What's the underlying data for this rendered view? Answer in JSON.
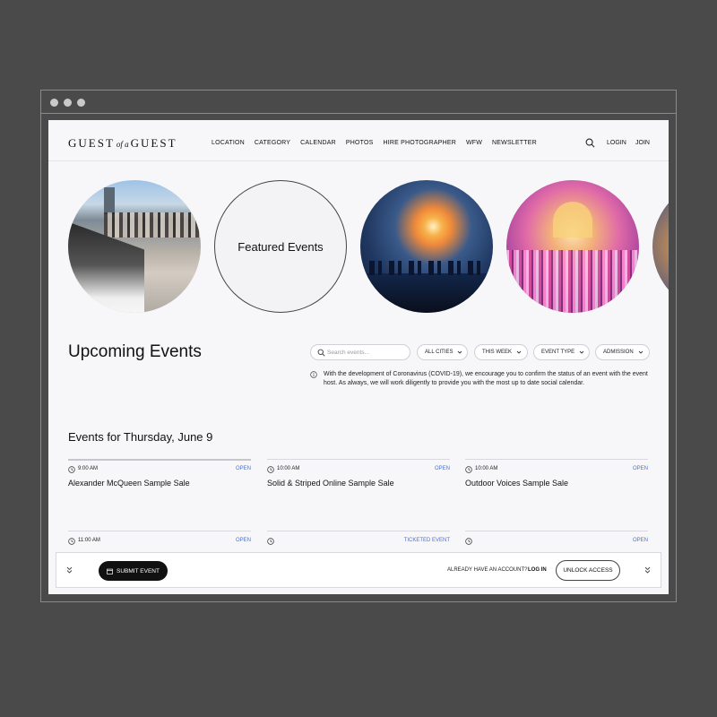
{
  "header": {
    "logo": {
      "left": "GUEST",
      "of": "of a",
      "right": "GUEST"
    },
    "nav": [
      "LOCATION",
      "CATEGORY",
      "CALENDAR",
      "PHOTOS",
      "HIRE PHOTOGRAPHER",
      "WFW",
      "NEWSLETTER"
    ],
    "login": "LOGIN",
    "join": "JOIN"
  },
  "featured": {
    "label": "Featured Events"
  },
  "upcoming": {
    "title": "Upcoming Events",
    "search_placeholder": "Search events...",
    "filters": [
      "ALL CITIES",
      "THIS WEEK",
      "EVENT TYPE",
      "ADMISSION"
    ],
    "notice": "With the development of Coronavirus (COVID-19), we encourage you to confirm the status of an event with the event host. As always, we will work diligently to provide you with the most up to date social calendar."
  },
  "day": {
    "heading": "Events for Thursday, June 9"
  },
  "events": [
    {
      "time": "9:00 AM",
      "status": "OPEN",
      "title": "Alexander McQueen Sample Sale"
    },
    {
      "time": "10:00 AM",
      "status": "OPEN",
      "title": "Solid & Striped Online Sample Sale"
    },
    {
      "time": "10:00 AM",
      "status": "OPEN",
      "title": "Outdoor Voices Sample Sale"
    },
    {
      "time": "11:00 AM",
      "status": "OPEN",
      "title": ""
    },
    {
      "time": "",
      "status": "TICKETED EVENT",
      "title": ""
    },
    {
      "time": "",
      "status": "OPEN",
      "title": ""
    }
  ],
  "bottom": {
    "submit": "SUBMIT EVENT",
    "already": "ALREADY HAVE AN ACCOUNT?",
    "login": "LOG IN",
    "unlock": "UNLOCK ACCESS"
  }
}
